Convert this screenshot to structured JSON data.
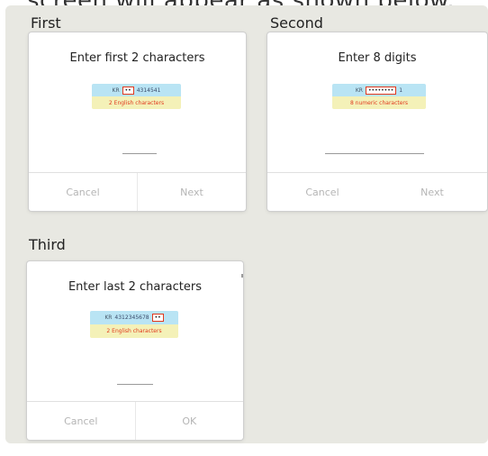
{
  "header_text": "screen will appear as shown below.",
  "steps": [
    {
      "caption": "First",
      "title": "Enter first 2 characters",
      "card_prefix": "KR",
      "card_code": "4314541",
      "card_mask": "••",
      "card_note": "2 English characters",
      "buttons": [
        "Cancel",
        "Next"
      ]
    },
    {
      "caption": "Second",
      "title": "Enter 8 digits",
      "card_prefix": "KR",
      "card_code": "1",
      "card_mask": "••••••••",
      "card_note": "8 numeric characters",
      "buttons": [
        "Cancel",
        "Next"
      ]
    },
    {
      "caption": "Third",
      "title": "Enter last 2 characters",
      "card_prefix": "KR",
      "card_code": "4312345678",
      "card_mask": "••",
      "card_note": "2 English characters",
      "buttons": [
        "Cancel",
        "OK"
      ]
    }
  ],
  "colors": {
    "panel_background": "#e8e8e2",
    "card_top": "#b9e4f4",
    "card_bottom": "#f4f1b8",
    "highlight": "#e03a1e",
    "button_text": "#b5b5b5"
  }
}
